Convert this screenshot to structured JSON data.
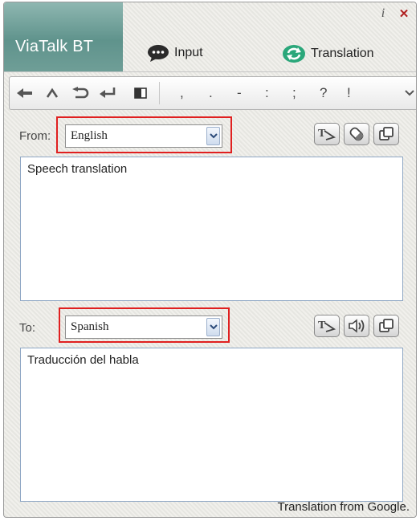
{
  "app": {
    "brand": "ViaTalk BT"
  },
  "titlebar": {
    "info_glyph": "i",
    "close_glyph": "✕"
  },
  "tabs": [
    {
      "label": "Input",
      "icon": "chat-bubble-icon"
    },
    {
      "label": "Translation",
      "icon": "refresh-icon"
    }
  ],
  "toolbar": {
    "punctuation": [
      ",",
      ".",
      "-",
      ":",
      ";",
      "?",
      "!"
    ]
  },
  "source": {
    "label": "From:",
    "language": "English",
    "text": "Speech translation",
    "actions": [
      "translate-icon",
      "eraser-icon",
      "copy-icon"
    ]
  },
  "target": {
    "label": "To:",
    "language": "Spanish",
    "text": "Traducción del habla",
    "actions": [
      "translate-icon",
      "speaker-icon",
      "copy-icon"
    ]
  },
  "footer": {
    "credit": "Translation from Google."
  },
  "colors": {
    "brand": "#6f9e97",
    "highlight": "#e02020",
    "tab_icon_green": "#2aa77a"
  }
}
